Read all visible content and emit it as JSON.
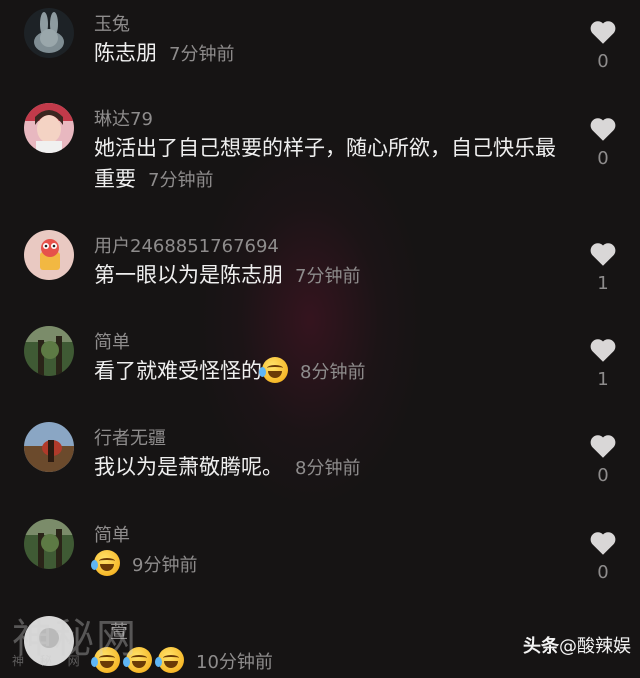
{
  "comments": [
    {
      "username": "玉兔",
      "text": "陈志朋",
      "time": "7分钟前",
      "likes": "0"
    },
    {
      "username": "琳达79",
      "text": "她活出了自己想要的样子，随心所欲，自己快乐最重要",
      "time": "7分钟前",
      "likes": "0"
    },
    {
      "username": "用户2468851767694",
      "text": "第一眼以为是陈志朋",
      "time": "7分钟前",
      "likes": "1"
    },
    {
      "username": "简单",
      "text": "看了就难受怪怪的",
      "time": "8分钟前",
      "likes": "1"
    },
    {
      "username": "行者无疆",
      "text": "我以为是萧敬腾呢。",
      "time": "8分钟前",
      "likes": "0"
    },
    {
      "username": "简单",
      "text": "",
      "time": "9分钟前",
      "likes": "0"
    },
    {
      "username": "萱",
      "text": "",
      "time": "10分钟前",
      "likes": ""
    }
  ],
  "watermark": {
    "main": "神秘网",
    "sub": "神 秘 网"
  },
  "brand": {
    "prefix": "头条",
    "handle": "@酸辣娱"
  },
  "colors": {
    "background": "#161414",
    "text": "#efefef",
    "muted": "#8e8c8c",
    "heart": "#d9d7d7"
  }
}
